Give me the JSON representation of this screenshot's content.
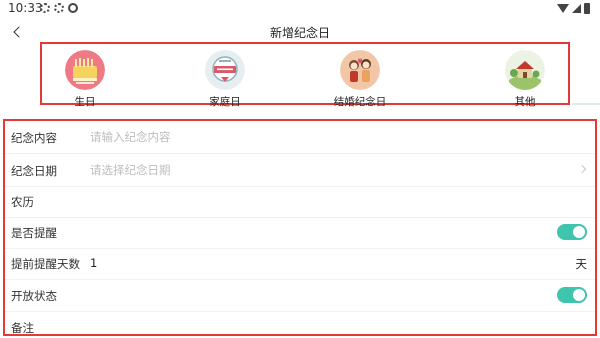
{
  "status_bar": {
    "time": "10:33"
  },
  "nav": {
    "title": "新增纪念日"
  },
  "categories": [
    {
      "label": "生日",
      "icon": "birthday-cake-icon"
    },
    {
      "label": "家庭日",
      "icon": "family-badge-icon"
    },
    {
      "label": "结婚纪念日",
      "icon": "wedding-couple-icon"
    },
    {
      "label": "其他",
      "icon": "house-landscape-icon"
    }
  ],
  "form": {
    "content": {
      "label": "纪念内容",
      "placeholder": "请输入纪念内容"
    },
    "date": {
      "label": "纪念日期",
      "placeholder": "请选择纪念日期"
    },
    "lunar": {
      "label": "农历"
    },
    "remind": {
      "label": "是否提醒",
      "enabled": true
    },
    "advance_days": {
      "label": "提前提醒天数",
      "value": "1",
      "unit": "天"
    },
    "open_status": {
      "label": "开放状态",
      "enabled": true
    },
    "note": {
      "label": "备注"
    }
  },
  "colors": {
    "accent": "#3fc4ad",
    "highlight_border": "#e53935"
  }
}
